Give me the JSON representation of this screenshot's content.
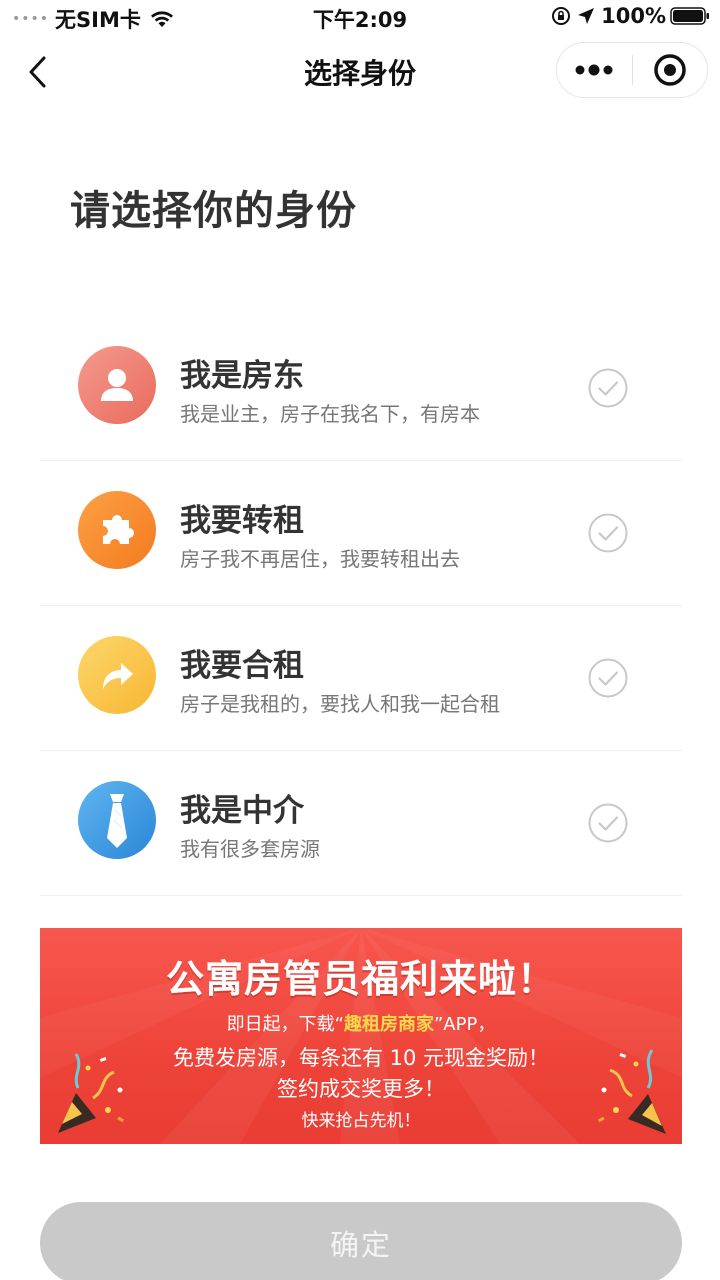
{
  "status_bar": {
    "signal": "••••",
    "carrier": "无SIM卡",
    "time": "下午2:09",
    "battery": "100%"
  },
  "nav": {
    "title": "选择身份",
    "back_icon": "chevron-left-icon",
    "more_icon": "more-dots-icon",
    "close_icon": "target-close-icon"
  },
  "heading": "请选择你的身份",
  "options": [
    {
      "title": "我是房东",
      "desc": "我是业主，房子在我名下，有房本",
      "icon": "user-icon",
      "color": "#ee7a6d"
    },
    {
      "title": "我要转租",
      "desc": "房子我不再居住，我要转租出去",
      "icon": "puzzle-icon",
      "color": "#f78a2c"
    },
    {
      "title": "我要合租",
      "desc": "房子是我租的，要找人和我一起合租",
      "icon": "share-arrow-icon",
      "color": "#f9c443"
    },
    {
      "title": "我是中介",
      "desc": "我有很多套房源",
      "icon": "tie-icon",
      "color": "#3d97e0"
    }
  ],
  "banner": {
    "title": "公寓房管员福利来啦！",
    "line1_prefix": "即日起，下载“",
    "line1_brand": "趣租房商家",
    "line1_suffix": "”APP，",
    "line2": "免费发房源，每条还有 10 元现金奖励！",
    "line3": "签约成交奖更多！",
    "line4": "快来抢占先机！"
  },
  "confirm_label": "确定",
  "colors": {
    "accent_banner": "#ee4339",
    "brand_highlight": "#ffd84a",
    "confirm_disabled": "#c9c9c9",
    "check_gray": "#c8c8c8"
  }
}
